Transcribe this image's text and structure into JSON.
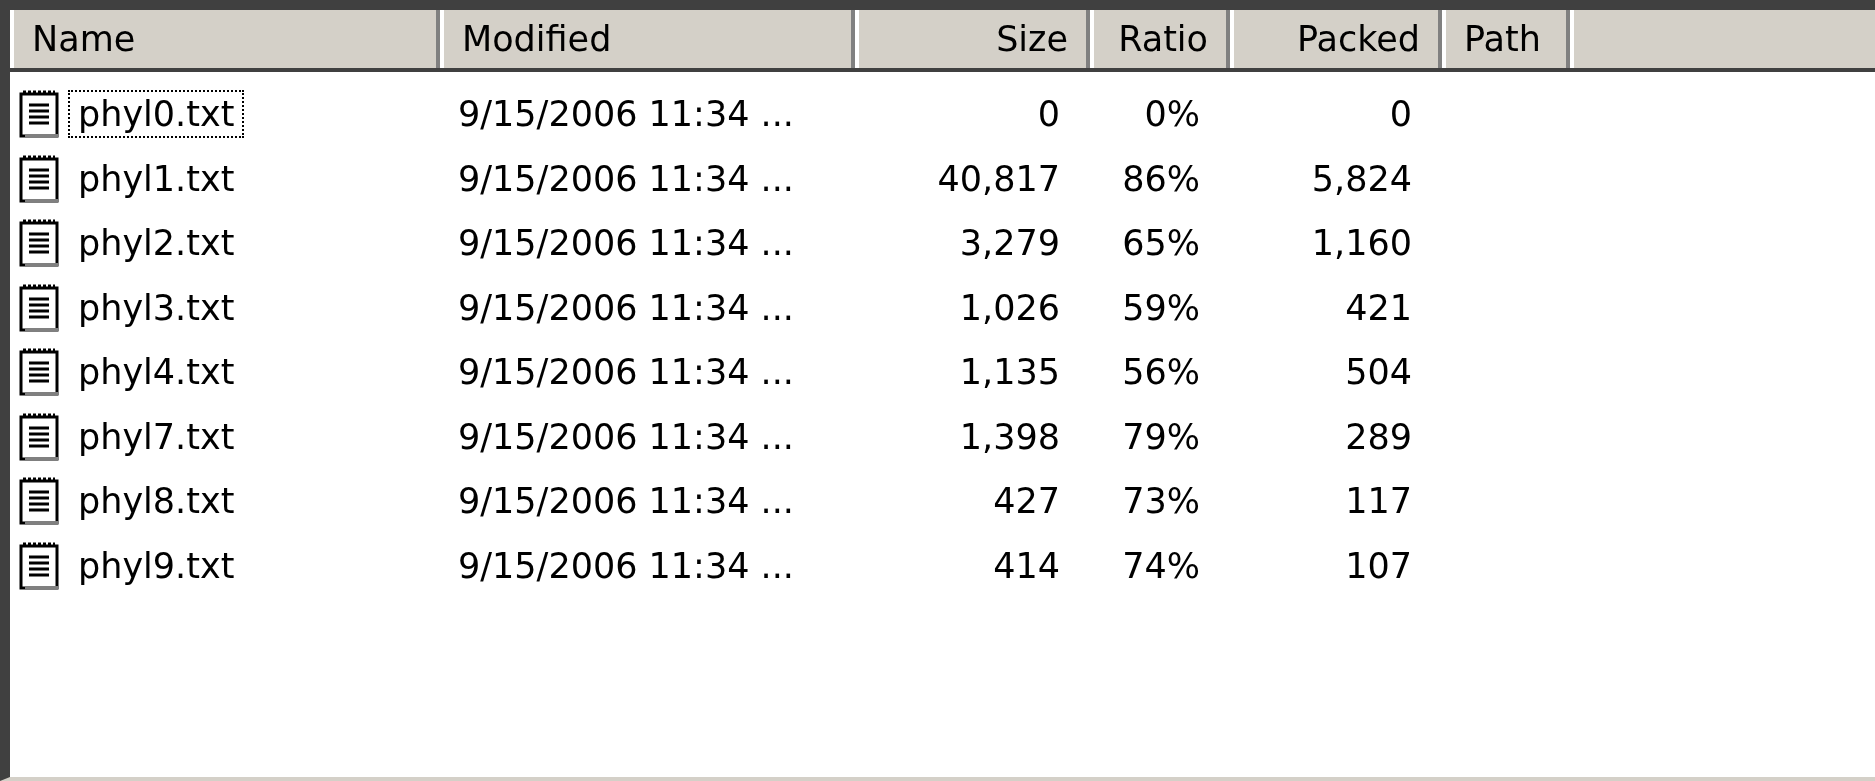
{
  "columns": [
    {
      "label": "Name"
    },
    {
      "label": "Modified"
    },
    {
      "label": "Size"
    },
    {
      "label": "Ratio"
    },
    {
      "label": "Packed"
    },
    {
      "label": "Path"
    }
  ],
  "rows": [
    {
      "name": "phyl0.txt",
      "modified": "9/15/2006 11:34 ...",
      "size": "0",
      "ratio": "0%",
      "packed": "0",
      "focused": true
    },
    {
      "name": "phyl1.txt",
      "modified": "9/15/2006 11:34 ...",
      "size": "40,817",
      "ratio": "86%",
      "packed": "5,824",
      "focused": false
    },
    {
      "name": "phyl2.txt",
      "modified": "9/15/2006 11:34 ...",
      "size": "3,279",
      "ratio": "65%",
      "packed": "1,160",
      "focused": false
    },
    {
      "name": "phyl3.txt",
      "modified": "9/15/2006 11:34 ...",
      "size": "1,026",
      "ratio": "59%",
      "packed": "421",
      "focused": false
    },
    {
      "name": "phyl4.txt",
      "modified": "9/15/2006 11:34 ...",
      "size": "1,135",
      "ratio": "56%",
      "packed": "504",
      "focused": false
    },
    {
      "name": "phyl7.txt",
      "modified": "9/15/2006 11:34 ...",
      "size": "1,398",
      "ratio": "79%",
      "packed": "289",
      "focused": false
    },
    {
      "name": "phyl8.txt",
      "modified": "9/15/2006 11:34 ...",
      "size": "427",
      "ratio": "73%",
      "packed": "117",
      "focused": false
    },
    {
      "name": "phyl9.txt",
      "modified": "9/15/2006 11:34 ...",
      "size": "414",
      "ratio": "74%",
      "packed": "107",
      "focused": false
    }
  ]
}
